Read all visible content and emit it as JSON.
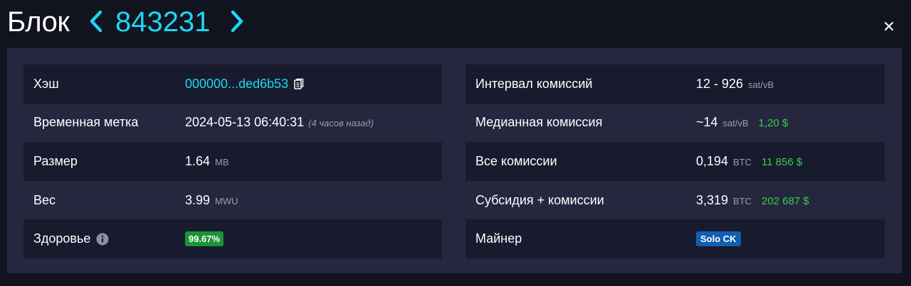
{
  "header": {
    "title": "Блок",
    "block_number": "843231",
    "prev_icon": "chevron-left-icon",
    "next_icon": "chevron-right-icon",
    "close_icon": "close-icon"
  },
  "colors": {
    "accent": "#1bd8f4",
    "usd_green": "#3bcc49",
    "health_badge": "#1a9436",
    "miner_badge": "#105fb0",
    "panel": "#24273e",
    "row_stripe": "#181b2d"
  },
  "left": {
    "hash": {
      "label": "Хэш",
      "value": "000000...ded6b53",
      "icon": "copy-icon"
    },
    "timestamp": {
      "label": "Временная метка",
      "value": "2024-05-13 06:40:31",
      "relative": "(4 часов назад)"
    },
    "size": {
      "label": "Размер",
      "value": "1.64",
      "unit": "MB"
    },
    "weight": {
      "label": "Вес",
      "value": "3.99",
      "unit": "MWU"
    },
    "health": {
      "label": "Здоровье",
      "icon": "info-icon",
      "value": "99.67%"
    }
  },
  "right": {
    "fee_span": {
      "label": "Интервал комиссий",
      "value": "12 - 926",
      "unit": "sat/vB"
    },
    "median_fee": {
      "label": "Медианная комиссия",
      "value": "~14",
      "unit": "sat/vB",
      "usd": "1,20 $"
    },
    "total_fees": {
      "label": "Все комиссии",
      "value": "0,194",
      "unit": "BTC",
      "usd": "11 856 $"
    },
    "subsidy_fees": {
      "label": "Субсидия + комиссии",
      "value": "3,319",
      "unit": "BTC",
      "usd": "202 687 $"
    },
    "miner": {
      "label": "Майнер",
      "value": "Solo CK"
    }
  }
}
